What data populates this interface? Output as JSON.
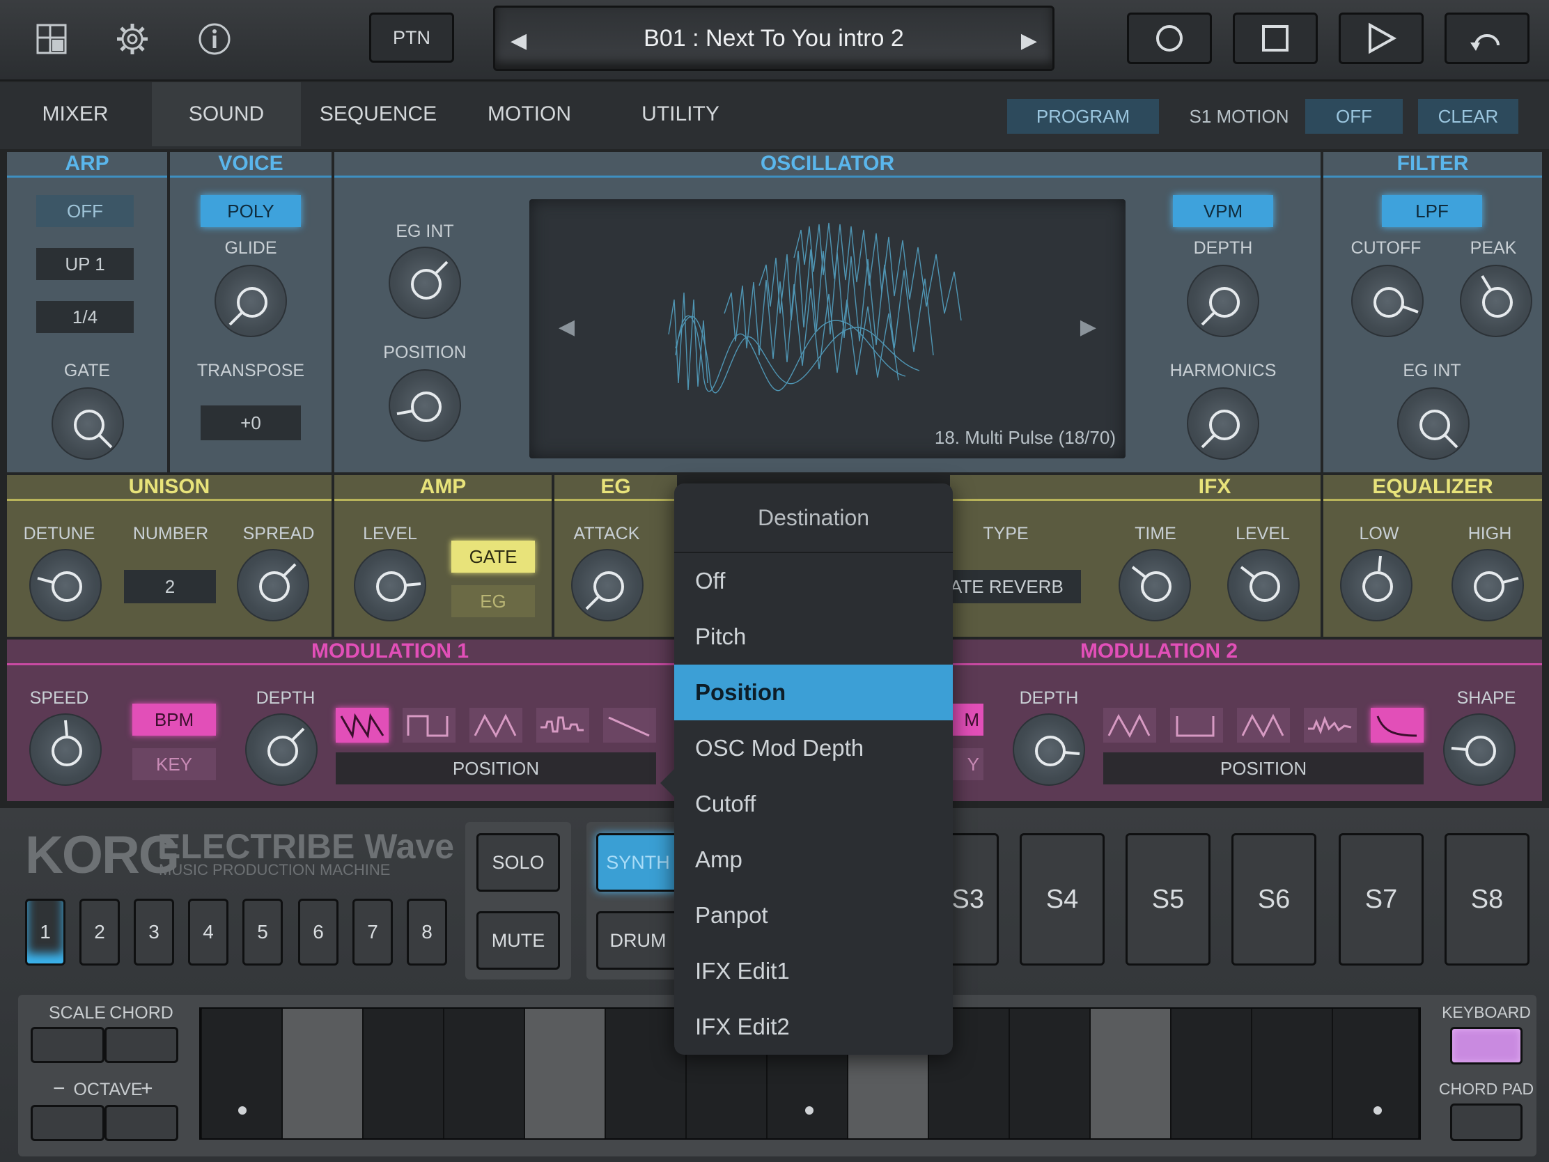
{
  "topbar": {
    "icons": [
      "layout-icon",
      "gear-icon",
      "info-icon"
    ],
    "ptn_label": "PTN",
    "pattern_name": "B01 : Next To You intro 2",
    "prev_arrow": "◀",
    "next_arrow": "▶",
    "transport": [
      "record-icon",
      "stop-icon",
      "play-icon",
      "loop-icon"
    ]
  },
  "tabs": [
    {
      "label": "MIXER"
    },
    {
      "label": "SOUND"
    },
    {
      "label": "SEQUENCE"
    },
    {
      "label": "MOTION"
    },
    {
      "label": "UTILITY"
    }
  ],
  "tab_active": "SOUND",
  "motion_bar": {
    "program": "PROGRAM",
    "s1_motion": "S1 MOTION",
    "off": "OFF",
    "clear": "CLEAR"
  },
  "arp": {
    "title": "ARP",
    "off": "OFF",
    "mode": "UP 1",
    "rate": "1/4",
    "gate": "GATE"
  },
  "voice": {
    "title": "VOICE",
    "poly": "POLY",
    "glide": "GLIDE",
    "transpose": "TRANSPOSE",
    "transpose_value": "+0"
  },
  "oscillator": {
    "title": "OSCILLATOR",
    "eg_int": "EG INT",
    "position": "POSITION",
    "wave_name": "18. Multi Pulse (18/70)",
    "vpm": "VPM",
    "depth": "DEPTH",
    "harmonics": "HARMONICS",
    "left_arrow": "◀",
    "right_arrow": "▶"
  },
  "filter": {
    "title": "FILTER",
    "lpf": "LPF",
    "cutoff": "CUTOFF",
    "peak": "PEAK",
    "eg_int": "EG INT"
  },
  "unison": {
    "title": "UNISON",
    "detune": "DETUNE",
    "number": "NUMBER",
    "number_value": "2",
    "spread": "SPREAD"
  },
  "amp": {
    "title": "AMP",
    "level": "LEVEL",
    "gate": "GATE",
    "eg": "EG"
  },
  "eg": {
    "title": "EG",
    "attack": "ATTACK"
  },
  "ifx": {
    "title": "IFX",
    "type": "TYPE",
    "type_value": "ATE REVERB",
    "time": "TIME",
    "level": "LEVEL"
  },
  "equalizer": {
    "title": "EQUALIZER",
    "low": "LOW",
    "high": "HIGH"
  },
  "mod1": {
    "title": "MODULATION 1",
    "speed": "SPEED",
    "bpm": "BPM",
    "key": "KEY",
    "depth": "DEPTH",
    "destination": "POSITION"
  },
  "mod2": {
    "title": "MODULATION 2",
    "depth": "DEPTH",
    "shape": "SHAPE",
    "bpm_partial": "M",
    "key_partial": "Y",
    "destination": "POSITION"
  },
  "brand": {
    "korg": "KORG",
    "product": "ELECTRIBE Wave",
    "subtitle": "MUSIC PRODUCTION MACHINE"
  },
  "parts": [
    "1",
    "2",
    "3",
    "4",
    "5",
    "6",
    "7",
    "8"
  ],
  "solo": "SOLO",
  "mute": "MUTE",
  "synth": "SYNTH",
  "drum": "DRUM",
  "pads": [
    "S3",
    "S4",
    "S5",
    "S6",
    "S7",
    "S8"
  ],
  "keyboard": {
    "scale": "SCALE",
    "chord": "CHORD",
    "octave": "OCTAVE",
    "minus": "−",
    "plus": "+",
    "keyboard_label": "KEYBOARD",
    "chord_pad": "CHORD PAD"
  },
  "dropdown": {
    "header": "Destination",
    "items": [
      "Off",
      "Pitch",
      "Position",
      "OSC Mod Depth",
      "Cutoff",
      "Amp",
      "Panpot",
      "IFX Edit1",
      "IFX Edit2"
    ],
    "selected": "Position"
  },
  "colors": {
    "accent_blue": "#3ea2dc",
    "yellow": "#e8e37a",
    "magenta": "#e24fb8",
    "panel_blue": "#4b5963"
  }
}
